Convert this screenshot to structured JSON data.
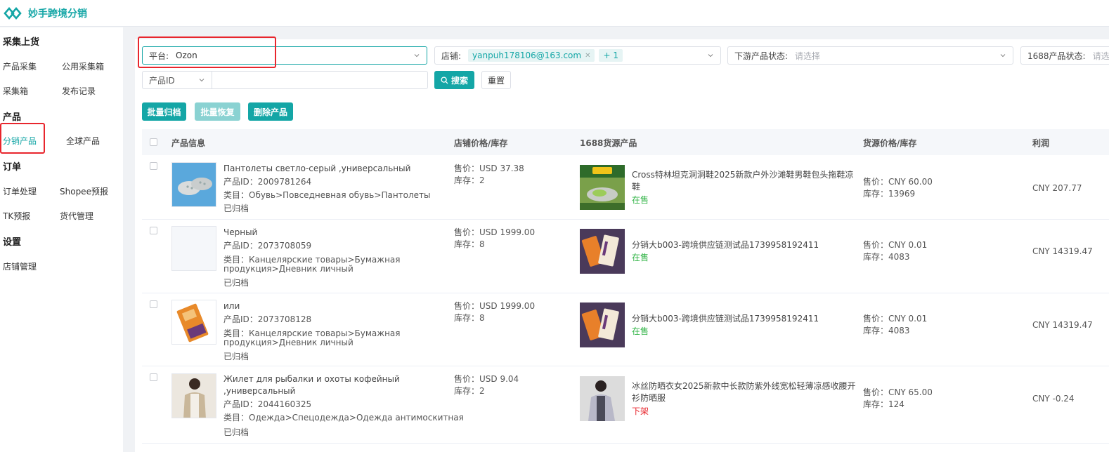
{
  "app": {
    "title": "妙手跨境分销",
    "logo_icon": "diamond-logo-icon"
  },
  "sidebar": {
    "sections": [
      {
        "title": "采集上货",
        "items": [
          "产品采集",
          "公用采集箱",
          "采集箱",
          "发布记录"
        ]
      },
      {
        "title": "产品",
        "items": [
          "分销产品",
          "全球产品"
        ],
        "active": "分销产品"
      },
      {
        "title": "订单",
        "items": [
          "订单处理",
          "Shopee预报",
          "TK预报",
          "货代管理"
        ]
      },
      {
        "title": "设置",
        "items": [
          "店铺管理"
        ]
      }
    ]
  },
  "filters": {
    "platform": {
      "label": "平台:",
      "value": "Ozon"
    },
    "shop": {
      "label": "店铺:",
      "tag": "yanpuh178106@163.com",
      "more": "+ 1"
    },
    "downstream_status": {
      "label": "下游产品状态:",
      "placeholder": "请选择"
    },
    "source_status": {
      "label": "1688产品状态:",
      "placeholder": "请选"
    },
    "id_type": {
      "value": "产品ID"
    },
    "id_input": {
      "placeholder": ""
    },
    "search_label": "搜索",
    "reset_label": "重置"
  },
  "actions": {
    "archive": "批量归档",
    "restore": "批量恢复",
    "delete": "删除产品"
  },
  "table": {
    "headers": [
      "产品信息",
      "店铺价格/库存",
      "1688货源产品",
      "货源价格/库存",
      "利润"
    ],
    "rows": [
      {
        "title": "Пантолеты светло-серый ,универсальный",
        "title2": "",
        "id": "产品ID：2009781264",
        "category": "类目：Обувь>Повседневная обувь>Пантолеты",
        "category2": "",
        "archived": "已归档",
        "price": "售价：USD 37.38",
        "stock": "库存：2",
        "source_title": "Cross特林坦克洞洞鞋2025新款户外沙滩鞋男鞋包头拖鞋凉",
        "source_title2": "鞋",
        "source_status": "在售",
        "source_price": "售价：CNY 60.00",
        "source_stock": "库存：13969",
        "profit": "CNY 207.77"
      },
      {
        "title": "Черный",
        "title2": "",
        "id": "产品ID：2073708059",
        "category": "类目：Канцелярские товары>Бумажная",
        "category2": "продукция>Дневник личный",
        "archived": "已归档",
        "price": "售价：USD 1999.00",
        "stock": "库存：8",
        "source_title": "分销大b003-跨境供应链测试品1739958192411",
        "source_title2": "",
        "source_status": "在售",
        "source_price": "售价：CNY 0.01",
        "source_stock": "库存：4083",
        "profit": "CNY 14319.47"
      },
      {
        "title": "или",
        "title2": "",
        "id": "产品ID：2073708128",
        "category": "类目：Канцелярские товары>Бумажная",
        "category2": "продукция>Дневник личный",
        "archived": "已归档",
        "price": "售价：USD 1999.00",
        "stock": "库存：8",
        "source_title": "分销大b003-跨境供应链测试品1739958192411",
        "source_title2": "",
        "source_status": "在售",
        "source_price": "售价：CNY 0.01",
        "source_stock": "库存：4083",
        "profit": "CNY 14319.47"
      },
      {
        "title": "Жилет для рыбалки и охоты кофейный",
        "title2": ",универсальный",
        "id": "产品ID：2044160325",
        "category": "类目：Одежда>Спецодежда>Одежда антимоскитная",
        "category2": "",
        "archived": "已归档",
        "price": "售价：USD 9.04",
        "stock": "库存：2",
        "source_title": "冰丝防晒衣女2025新款中长款防紫外线宽松轻薄凉感收腰开",
        "source_title2": "衫防晒服",
        "source_status": "下架",
        "source_price": "售价：CNY 65.00",
        "source_stock": "库存：124",
        "profit": "CNY -0.24"
      }
    ]
  },
  "icons": {
    "chevron": "chevron-down-icon",
    "search": "search-icon",
    "close": "close-icon"
  },
  "colors": {
    "accent": "#14a6a6",
    "highlight": "#e8262d",
    "on_sale": "#2fb344",
    "off_sale": "#e8262d"
  }
}
